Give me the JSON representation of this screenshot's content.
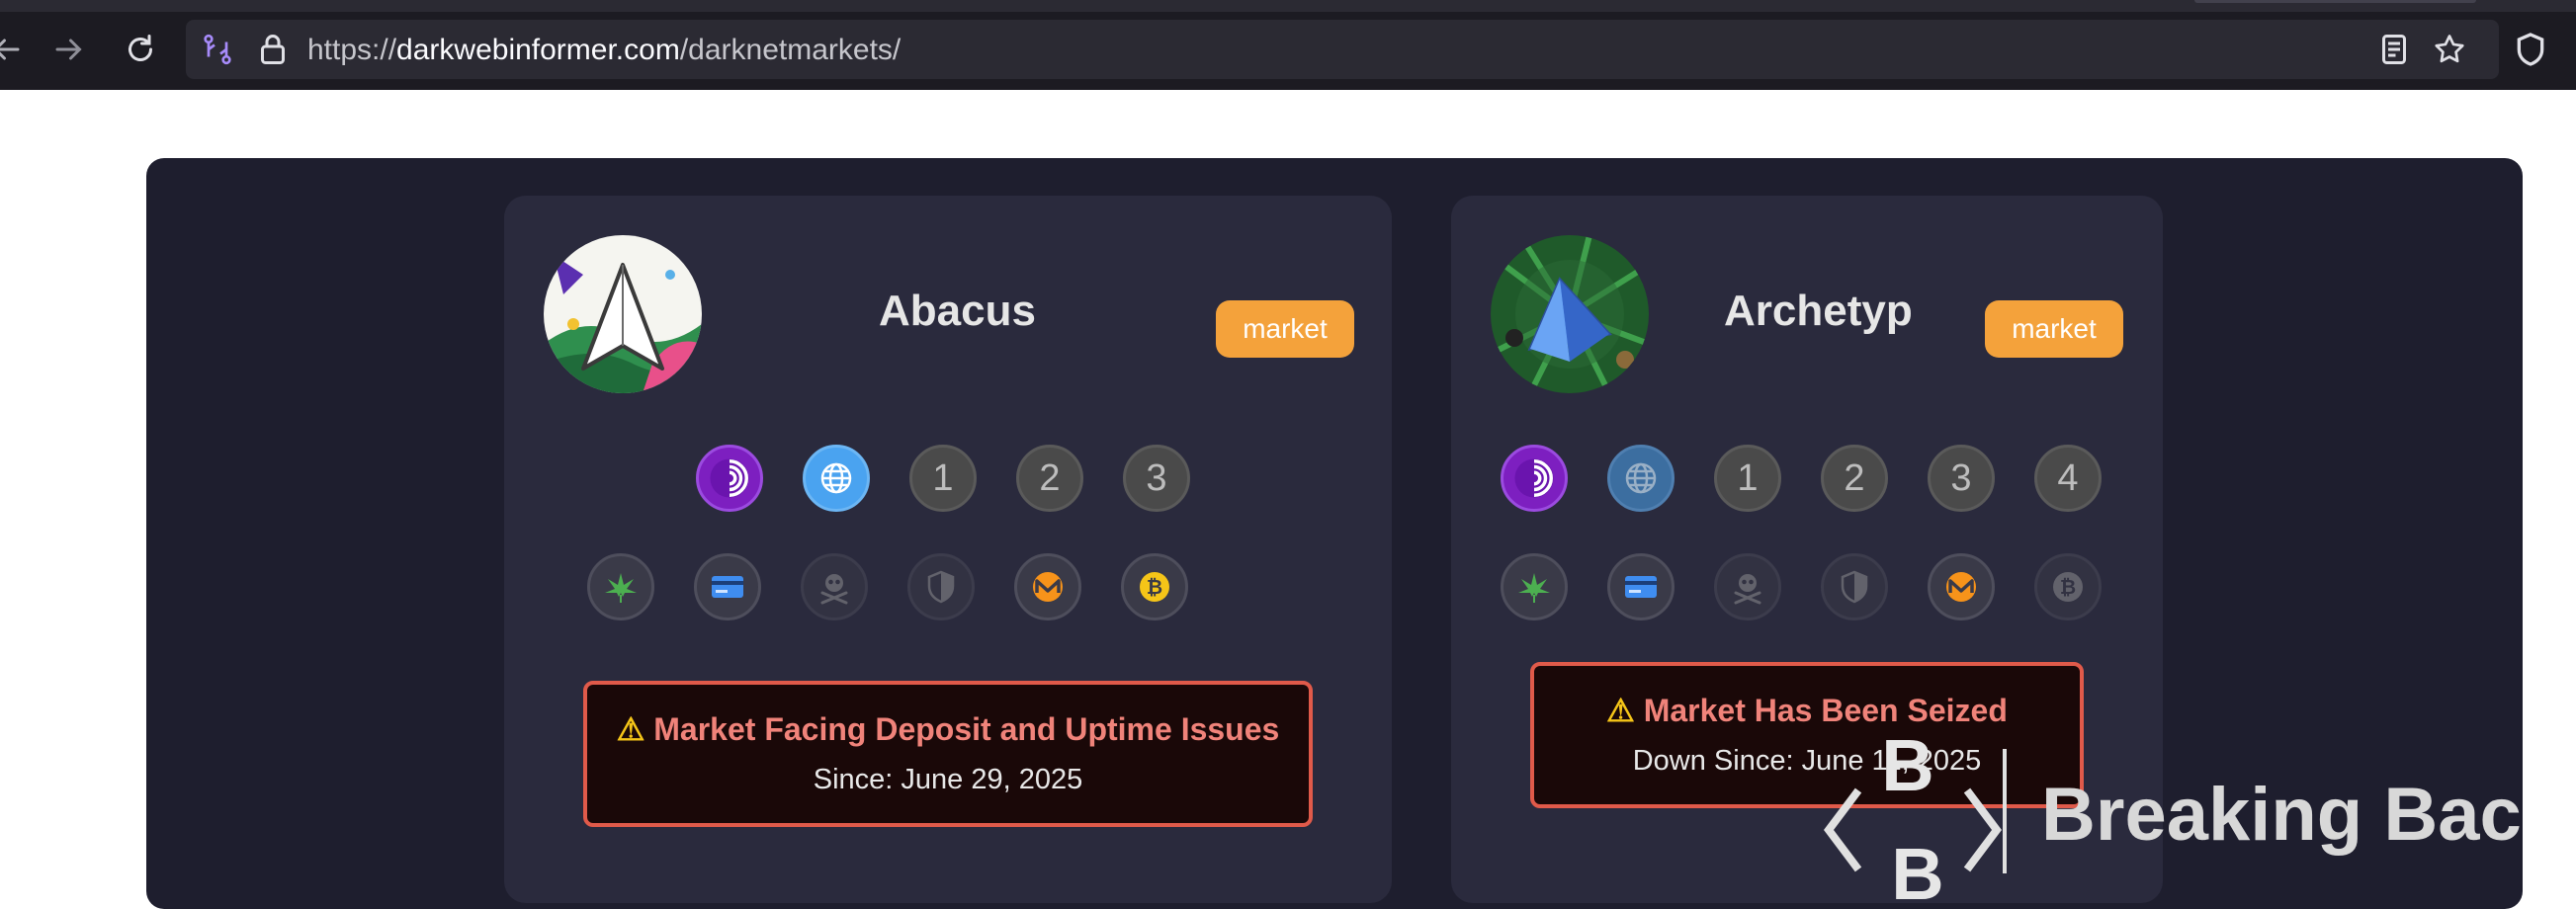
{
  "browser": {
    "url_host": "darkwebinformer.com",
    "url_path": "/darknetmarkets/",
    "url_scheme": "https://"
  },
  "markets": [
    {
      "name": "Abacus",
      "badge": "market",
      "mirrors": [
        "1",
        "2",
        "3"
      ],
      "alert_title": "Market Facing Deposit and Uptime Issues",
      "alert_sub": "Since: June 29, 2025"
    },
    {
      "name": "Archetyp",
      "badge": "market",
      "mirrors": [
        "1",
        "2",
        "3",
        "4"
      ],
      "alert_title": "Market Has Been Seized",
      "alert_sub": "Down Since: June 11, 2025"
    }
  ],
  "watermark": {
    "text": "Breaking Bac",
    "letters": [
      "B",
      "B"
    ]
  },
  "colors": {
    "badge": "#f4a23b",
    "alert_border": "#e05a4a",
    "alert_title": "#f0837a",
    "tor": "#7d1fc0",
    "clearnet": "#4aa3f0"
  }
}
